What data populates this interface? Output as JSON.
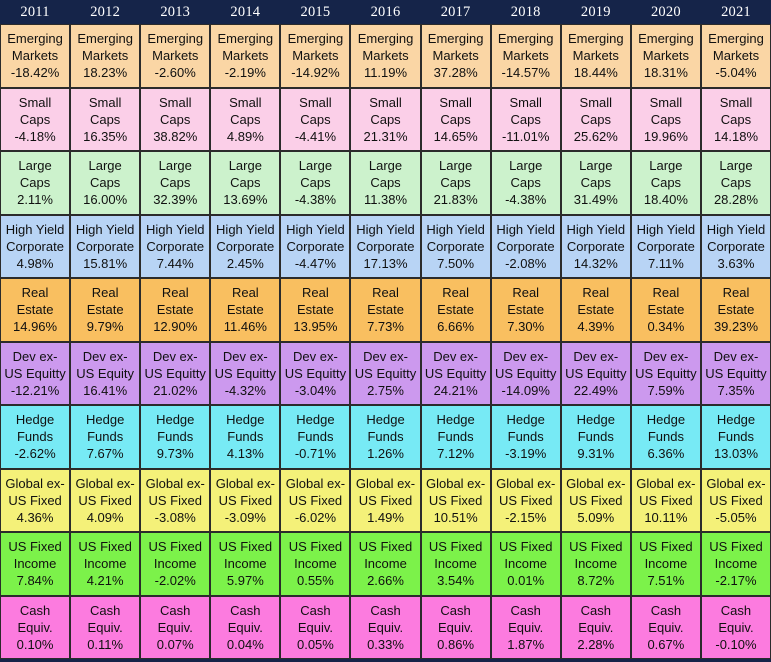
{
  "table": {
    "header": {
      "background": "#152449",
      "text_color": "#ffffff",
      "years": [
        "2011",
        "2012",
        "2013",
        "2014",
        "2015",
        "2016",
        "2017",
        "2018",
        "2019",
        "2020",
        "2021"
      ]
    },
    "rows": [
      {
        "asset_class": "Emerging Markets",
        "name_lines": [
          "Emerging",
          "Markets"
        ],
        "color": "#fad6a5",
        "values": [
          "-18.42%",
          "18.23%",
          "-2.60%",
          "-2.19%",
          "-14.92%",
          "11.19%",
          "37.28%",
          "-14.57%",
          "18.44%",
          "18.31%",
          "-5.04%"
        ]
      },
      {
        "asset_class": "Small Caps",
        "name_lines": [
          "Small",
          "Caps"
        ],
        "color": "#fbcfe8",
        "values": [
          "-4.18%",
          "16.35%",
          "38.82%",
          "4.89%",
          "-4.41%",
          "21.31%",
          "14.65%",
          "-11.01%",
          "25.62%",
          "19.96%",
          "14.18%"
        ]
      },
      {
        "asset_class": "Large Caps",
        "name_lines": [
          "Large",
          "Caps"
        ],
        "color": "#ccf2cc",
        "values": [
          "2.11%",
          "16.00%",
          "32.39%",
          "13.69%",
          "-4.38%",
          "11.38%",
          "21.83%",
          "-4.38%",
          "31.49%",
          "18.40%",
          "28.28%"
        ]
      },
      {
        "asset_class": "High Yield Corporate",
        "name_lines": [
          "High Yield",
          "Corporate"
        ],
        "color": "#b8d4f5",
        "values": [
          "4.98%",
          "15.81%",
          "7.44%",
          "2.45%",
          "-4.47%",
          "17.13%",
          "7.50%",
          "-2.08%",
          "14.32%",
          "7.11%",
          "3.63%"
        ]
      },
      {
        "asset_class": "Real Estate",
        "name_lines": [
          "Real",
          "Estate"
        ],
        "color": "#f9bf60",
        "values": [
          "14.96%",
          "9.79%",
          "12.90%",
          "11.46%",
          "13.95%",
          "7.73%",
          "6.66%",
          "7.30%",
          "4.39%",
          "0.34%",
          "39.23%"
        ]
      },
      {
        "asset_class": "Dev ex-US Equity",
        "name_lines": [
          "Dev ex-",
          "US Equitty"
        ],
        "name_lines_by_col": [
          [
            "Dev ex-",
            "US Equitty"
          ],
          [
            "Dev ex-",
            "US Equity"
          ],
          [
            "Dev ex-",
            "US Equitty"
          ],
          [
            "Dev ex-",
            "US Equitty"
          ],
          [
            "Dev ex-",
            "US Equitty"
          ],
          [
            "Dev ex-",
            "US Equitty"
          ],
          [
            "Dev ex-",
            "US Equitty"
          ],
          [
            "Dev ex-",
            "US Equitty"
          ],
          [
            "Dev ex-",
            "US Equitty"
          ],
          [
            "Dev ex-",
            "US Equitty"
          ],
          [
            "Dev ex-",
            "US Equitty"
          ]
        ],
        "color": "#cc99ee",
        "values": [
          "-12.21%",
          "16.41%",
          "21.02%",
          "-4.32%",
          "-3.04%",
          "2.75%",
          "24.21%",
          "-14.09%",
          "22.49%",
          "7.59%",
          "7.35%"
        ]
      },
      {
        "asset_class": "Hedge Funds",
        "name_lines": [
          "Hedge",
          "Funds"
        ],
        "color": "#77eaf5",
        "values": [
          "-2.62%",
          "7.67%",
          "9.73%",
          "4.13%",
          "-0.71%",
          "1.26%",
          "7.12%",
          "-3.19%",
          "9.31%",
          "6.36%",
          "13.03%"
        ]
      },
      {
        "asset_class": "Global ex-US Fixed",
        "name_lines": [
          "Global ex-",
          "US Fixed"
        ],
        "color": "#f4f179",
        "values": [
          "4.36%",
          "4.09%",
          "-3.08%",
          "-3.09%",
          "-6.02%",
          "1.49%",
          "10.51%",
          "-2.15%",
          "5.09%",
          "10.11%",
          "-5.05%"
        ]
      },
      {
        "asset_class": "US Fixed Income",
        "name_lines": [
          "US Fixed",
          "Income"
        ],
        "color": "#7cf24a",
        "values": [
          "7.84%",
          "4.21%",
          "-2.02%",
          "5.97%",
          "0.55%",
          "2.66%",
          "3.54%",
          "0.01%",
          "8.72%",
          "7.51%",
          "-2.17%"
        ]
      },
      {
        "asset_class": "Cash Equivalents",
        "name_lines": [
          "Cash",
          "Equiv."
        ],
        "color": "#fc7bdf",
        "values": [
          "0.10%",
          "0.11%",
          "0.07%",
          "0.04%",
          "0.05%",
          "0.33%",
          "0.86%",
          "1.87%",
          "2.28%",
          "0.67%",
          "-0.10%"
        ]
      }
    ]
  }
}
